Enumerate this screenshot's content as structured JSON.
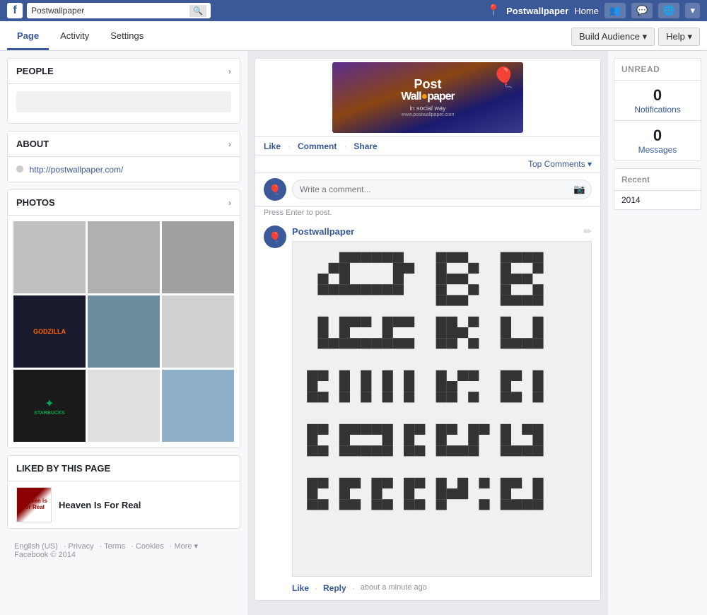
{
  "topnav": {
    "logo_text": "f",
    "search_placeholder": "Postwallpaper",
    "search_icon": "🔍",
    "page_name": "Postwallpaper",
    "home_label": "Home",
    "map_icon": "📍"
  },
  "subnav": {
    "tabs": [
      {
        "id": "page",
        "label": "Page",
        "active": true
      },
      {
        "id": "activity",
        "label": "Activity",
        "active": false
      },
      {
        "id": "settings",
        "label": "Settings",
        "active": false
      }
    ],
    "build_audience_label": "Build Audience",
    "help_label": "Help"
  },
  "sidebar": {
    "people_label": "PEOPLE",
    "about_label": "ABOUT",
    "about_url": "http://postwallpaper.com/",
    "photos_label": "PHOTOS",
    "liked_by_label": "LIKED BY THIS PAGE",
    "liked_item_name": "Heaven Is For Real"
  },
  "feed": {
    "like_label": "Like",
    "comment_label": "Comment",
    "share_label": "Share",
    "top_comments_label": "Top Comments ▾",
    "comment_placeholder": "Write a comment...",
    "press_enter_hint": "Press Enter to post.",
    "poster_name": "Postwallpaper",
    "reply_like_label": "Like",
    "reply_label": "Reply",
    "reply_time": "about a minute ago"
  },
  "right_panel": {
    "unread_label": "UNREAD",
    "notifications_count": "0",
    "notifications_label": "Notifications",
    "messages_count": "0",
    "messages_label": "Messages",
    "recent_label": "Recent",
    "recent_year": "2014"
  },
  "footer": {
    "language": "English (US)",
    "links": [
      "Privacy",
      "Terms",
      "Cookies",
      "More"
    ],
    "copyright": "Facebook © 2014"
  }
}
